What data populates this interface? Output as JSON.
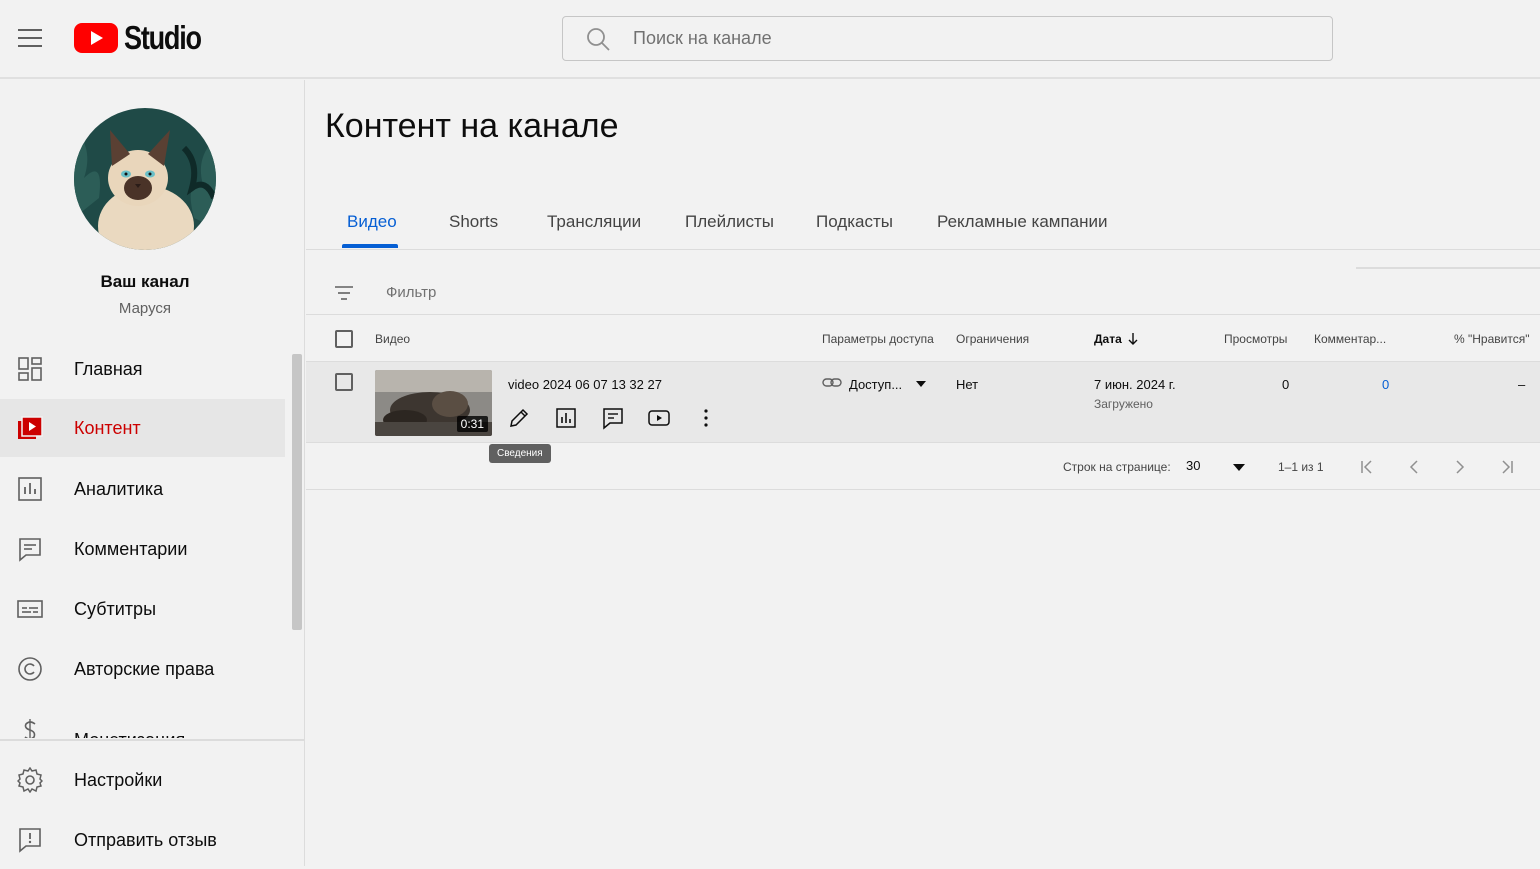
{
  "header": {
    "logo_text": "Studio",
    "search_placeholder": "Поиск на канале"
  },
  "sidebar": {
    "channel_name": "Ваш канал",
    "channel_handle": "Маруся",
    "items": [
      {
        "label": "Главная",
        "icon": "dashboard-icon"
      },
      {
        "label": "Контент",
        "icon": "content-icon",
        "active": true
      },
      {
        "label": "Аналитика",
        "icon": "analytics-icon"
      },
      {
        "label": "Комментарии",
        "icon": "comments-icon"
      },
      {
        "label": "Субтитры",
        "icon": "subtitles-icon"
      },
      {
        "label": "Авторские права",
        "icon": "copyright-icon"
      },
      {
        "label": "Монетизация",
        "icon": "monetization-icon"
      }
    ],
    "footer_items": [
      {
        "label": "Настройки",
        "icon": "gear-icon"
      },
      {
        "label": "Отправить отзыв",
        "icon": "feedback-icon"
      }
    ]
  },
  "main": {
    "title": "Контент на канале",
    "tabs": [
      {
        "label": "Видео",
        "active": true
      },
      {
        "label": "Shorts"
      },
      {
        "label": "Трансляции"
      },
      {
        "label": "Плейлисты"
      },
      {
        "label": "Подкасты"
      },
      {
        "label": "Рекламные кампании"
      }
    ],
    "filter_label": "Фильтр",
    "columns": {
      "video": "Видео",
      "visibility": "Параметры доступа",
      "restrictions": "Ограничения",
      "date": "Дата",
      "views": "Просмотры",
      "comments": "Комментар...",
      "likes": "% \"Нравится\""
    },
    "rows": [
      {
        "title": "video 2024 06 07 13 32 27",
        "duration": "0:31",
        "visibility": "Доступ...",
        "restrictions": "Нет",
        "date": "7 июн. 2024 г.",
        "date_status": "Загружено",
        "views": "0",
        "comments": "0",
        "likes": "–"
      }
    ],
    "tooltip": "Сведения",
    "pagination": {
      "rows_per_page_label": "Строк на странице:",
      "rows_per_page": "30",
      "range": "1–1 из 1"
    }
  },
  "colors": {
    "accent_blue": "#065fd4",
    "active_red": "#cc0000",
    "youtube_red": "#ff0000"
  }
}
